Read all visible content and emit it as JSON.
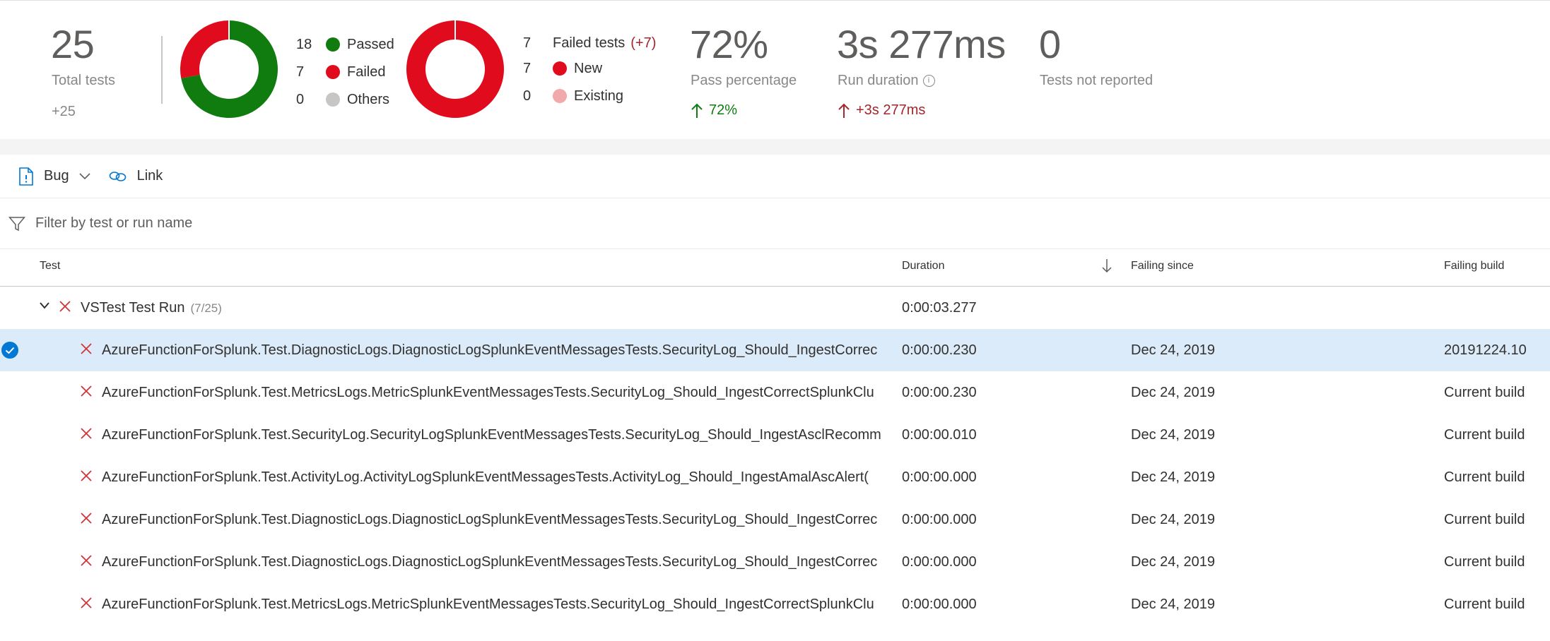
{
  "summary": {
    "total": {
      "value": "25",
      "label": "Total tests",
      "delta": "+25"
    },
    "outcome_chart": {
      "legend": [
        {
          "count": "18",
          "label": "Passed",
          "color": "#107c10"
        },
        {
          "count": "7",
          "label": "Failed",
          "color": "#e00b1c"
        },
        {
          "count": "0",
          "label": "Others",
          "color": "#c8c6c4"
        }
      ]
    },
    "failed_chart": {
      "count": "7",
      "title": "Failed tests",
      "delta": "(+7)",
      "legend": [
        {
          "count": "7",
          "label": "New",
          "color": "#e00b1c"
        },
        {
          "count": "0",
          "label": "Existing",
          "color": "#f1a9a9"
        }
      ]
    },
    "pass_percentage": {
      "value": "72%",
      "label": "Pass percentage",
      "delta": "72%"
    },
    "run_duration": {
      "value": "3s 277ms",
      "label": "Run duration",
      "delta": "+3s 277ms"
    },
    "not_reported": {
      "value": "0",
      "label": "Tests not reported"
    }
  },
  "chart_data": [
    {
      "type": "pie",
      "categories": [
        "Passed",
        "Failed",
        "Others"
      ],
      "values": [
        18,
        7,
        0
      ]
    },
    {
      "type": "pie",
      "categories": [
        "New",
        "Existing"
      ],
      "values": [
        7,
        0
      ]
    }
  ],
  "toolbar": {
    "bug_label": "Bug",
    "link_label": "Link"
  },
  "filter": {
    "placeholder": "Filter by test or run name"
  },
  "columns": {
    "test": "Test",
    "duration": "Duration",
    "failing_since": "Failing since",
    "failing_build": "Failing build"
  },
  "group": {
    "name": "VSTest Test Run",
    "count": "(7/25)",
    "duration": "0:00:03.277"
  },
  "rows": [
    {
      "test": "AzureFunctionForSplunk.Test.DiagnosticLogs.DiagnosticLogSplunkEventMessagesTests.SecurityLog_Should_IngestCorrec",
      "duration": "0:00:00.230",
      "since": "Dec 24, 2019",
      "build": "20191224.10"
    },
    {
      "test": "AzureFunctionForSplunk.Test.MetricsLogs.MetricSplunkEventMessagesTests.SecurityLog_Should_IngestCorrectSplunkClu",
      "duration": "0:00:00.230",
      "since": "Dec 24, 2019",
      "build": "Current build"
    },
    {
      "test": "AzureFunctionForSplunk.Test.SecurityLog.SecurityLogSplunkEventMessagesTests.SecurityLog_Should_IngestAsclRecomm",
      "duration": "0:00:00.010",
      "since": "Dec 24, 2019",
      "build": "Current build"
    },
    {
      "test": "AzureFunctionForSplunk.Test.ActivityLog.ActivityLogSplunkEventMessagesTests.ActivityLog_Should_IngestAmalAscAlert(",
      "duration": "0:00:00.000",
      "since": "Dec 24, 2019",
      "build": "Current build"
    },
    {
      "test": "AzureFunctionForSplunk.Test.DiagnosticLogs.DiagnosticLogSplunkEventMessagesTests.SecurityLog_Should_IngestCorrec",
      "duration": "0:00:00.000",
      "since": "Dec 24, 2019",
      "build": "Current build"
    },
    {
      "test": "AzureFunctionForSplunk.Test.DiagnosticLogs.DiagnosticLogSplunkEventMessagesTests.SecurityLog_Should_IngestCorrec",
      "duration": "0:00:00.000",
      "since": "Dec 24, 2019",
      "build": "Current build"
    },
    {
      "test": "AzureFunctionForSplunk.Test.MetricsLogs.MetricSplunkEventMessagesTests.SecurityLog_Should_IngestCorrectSplunkClu",
      "duration": "0:00:00.000",
      "since": "Dec 24, 2019",
      "build": "Current build"
    }
  ]
}
